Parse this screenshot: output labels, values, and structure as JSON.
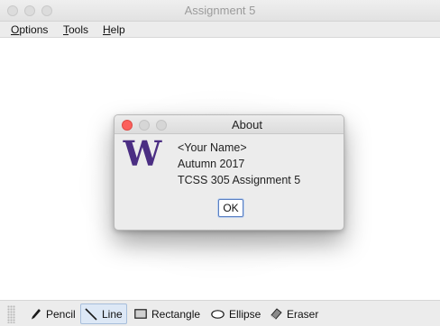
{
  "window": {
    "title": "Assignment 5"
  },
  "menubar": {
    "options": "Options",
    "tools": "Tools",
    "help": "Help"
  },
  "dialog": {
    "title": "About",
    "logo_text": "W",
    "lines": [
      "<Your Name>",
      "Autumn 2017",
      "TCSS 305 Assignment 5"
    ],
    "ok_label": "OK"
  },
  "toolbar": {
    "selected": "Line",
    "tools": [
      {
        "label": "Pencil",
        "icon": "pencil-icon"
      },
      {
        "label": "Line",
        "icon": "line-icon"
      },
      {
        "label": "Rectangle",
        "icon": "rectangle-icon"
      },
      {
        "label": "Ellipse",
        "icon": "ellipse-icon"
      },
      {
        "label": "Eraser",
        "icon": "eraser-icon"
      }
    ]
  },
  "colors": {
    "logo_purple": "#4b2e83",
    "close_red": "#fc605c",
    "selected_bg": "#dde8f6"
  }
}
